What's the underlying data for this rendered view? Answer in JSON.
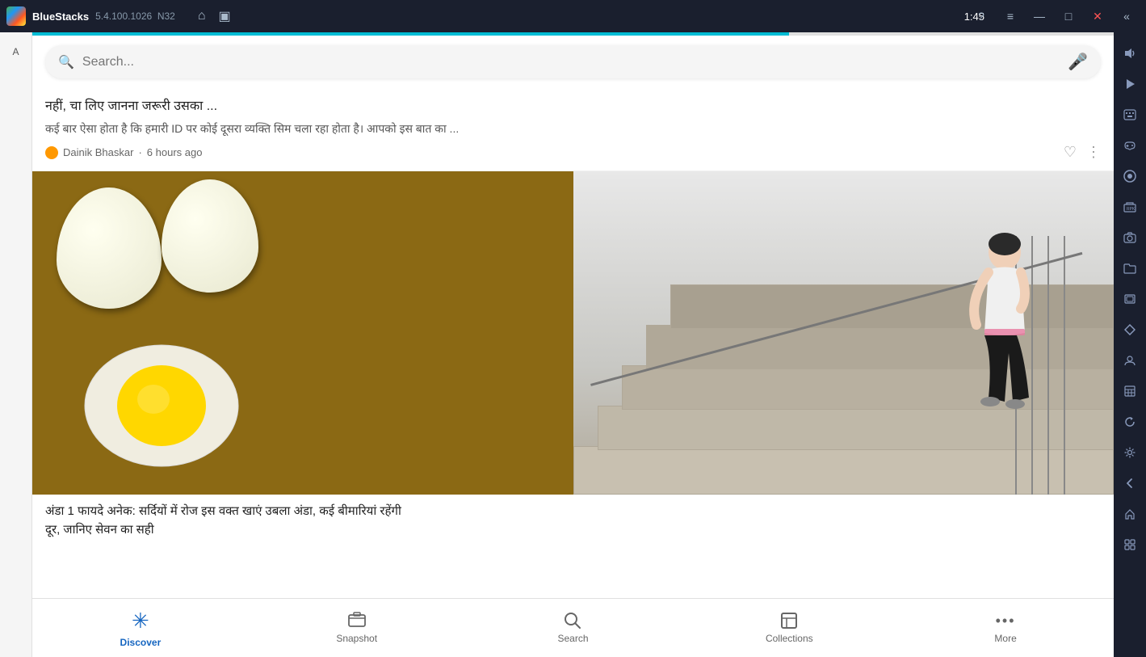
{
  "titleBar": {
    "appName": "BlueStacks",
    "version": "5.4.100.1026",
    "build": "N32",
    "time": "1:45",
    "homeIcon": "⌂",
    "squareIcon": "▣",
    "helpIcon": "?",
    "menuIcon": "≡",
    "minimizeIcon": "—",
    "maximizeIcon": "□",
    "closeIcon": "✕",
    "backArrow": "«"
  },
  "searchBar": {
    "placeholder": "Search...",
    "searchIcon": "🔍",
    "micIcon": "🎤"
  },
  "partialCard": {
    "title": "नहीं, चा लिए जानना जरूरी उसका ...",
    "description": "कई बार ऐसा होता है कि हमारी ID पर कोई दूसरा व्यक्ति सिम चला रहा होता है। आपको इस बात का ...",
    "source": "Dainik Bhaskar",
    "timeAgo": "6 hours ago",
    "heartIcon": "♡",
    "moreIcon": "⋮"
  },
  "imageCard": {
    "title": "अंडा 1 फायदे अनेक: सर्दियों में रोज इस वक्त खाएं उबला अंडा, कई बीमारियां रहेंगी",
    "titleContinued": "दूर, जानिए सेवन का सही"
  },
  "bottomNav": {
    "items": [
      {
        "id": "discover",
        "label": "Discover",
        "icon": "✳",
        "active": true
      },
      {
        "id": "snapshot",
        "label": "Snapshot",
        "icon": "⊡",
        "active": false
      },
      {
        "id": "search",
        "label": "Search",
        "icon": "⌕",
        "active": false
      },
      {
        "id": "collections",
        "label": "Collections",
        "icon": "⊟",
        "active": false
      },
      {
        "id": "more",
        "label": "More",
        "icon": "···",
        "active": false
      }
    ]
  },
  "rightSidebar": {
    "items": [
      {
        "id": "volume",
        "icon": "🔊"
      },
      {
        "id": "screen",
        "icon": "▶"
      },
      {
        "id": "keyboard",
        "icon": "⌨"
      },
      {
        "id": "gamepad",
        "icon": "🎮"
      },
      {
        "id": "record",
        "icon": "⏺"
      },
      {
        "id": "rpk",
        "icon": "📦"
      },
      {
        "id": "camera",
        "icon": "📷"
      },
      {
        "id": "folder",
        "icon": "📁"
      },
      {
        "id": "layers",
        "icon": "⧉"
      },
      {
        "id": "diamond",
        "icon": "◆"
      },
      {
        "id": "profile",
        "icon": "👤"
      },
      {
        "id": "stack",
        "icon": "⊞"
      },
      {
        "id": "refresh",
        "icon": "↺"
      },
      {
        "id": "settings",
        "icon": "⚙"
      },
      {
        "id": "back",
        "icon": "←"
      },
      {
        "id": "home",
        "icon": "⌂"
      },
      {
        "id": "apps",
        "icon": "⊞"
      }
    ]
  },
  "leftSidebar": {
    "label": "A"
  }
}
